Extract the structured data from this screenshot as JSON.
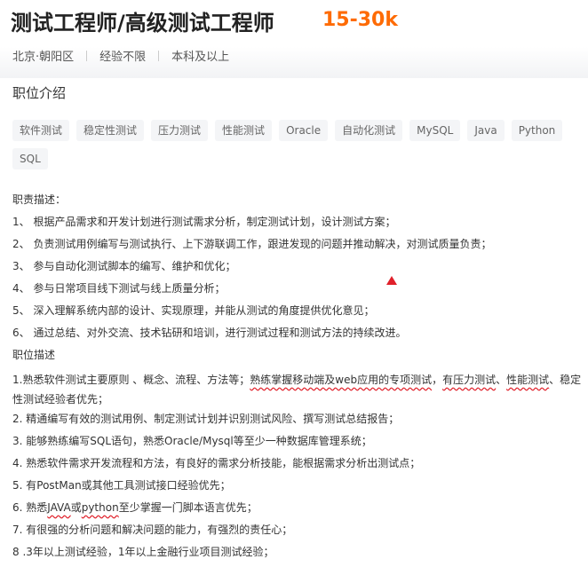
{
  "job": {
    "title": "测试工程师/高级测试工程师",
    "salary": "15-30k",
    "location": "北京·朝阳区",
    "experience": "经验不限",
    "education": "本科及以上"
  },
  "section_title": "职位介绍",
  "tags": [
    "软件测试",
    "稳定性测试",
    "压力测试",
    "性能测试",
    "Oracle",
    "自动化测试",
    "MySQL",
    "Java",
    "Python",
    "SQL"
  ],
  "duties_header": "职责描述：",
  "duties": [
    "1、 根据产品需求和开发计划进行测试需求分析，制定测试计划，设计测试方案；",
    "2、 负责测试用例编写与测试执行、上下游联调工作，跟进发现的问题并推动解决，对测试质量负责；",
    "3、 参与自动化测试脚本的编写、维护和优化；",
    "4、 参与日常项目线下测试与线上质量分析；",
    "5、 深入理解系统内部的设计、实现原理，并能从测试的角度提供优化意见；",
    "6、 通过总结、对外交流、技术钻研和培训，进行测试过程和测试方法的持续改进。"
  ],
  "requirements_header": "职位描述",
  "req1": {
    "prefix": "1.熟悉软件测试主要原则 、概念、流程、方法等；",
    "part_a": "熟练掌握移动端及web应用的专项测试",
    "mid1": "，",
    "part_b": "有压力测试",
    "mid2": "、",
    "part_c": "性能测试",
    "suffix": "、稳定性测试经验者优先；"
  },
  "requirements": [
    "2. 精通编写有效的测试用例、制定测试计划并识别测试风险、撰写测试总结报告；",
    "3. 能够熟练编写SQL语句，熟悉Oracle/Mysql等至少一种数据库管理系统；",
    "4. 熟悉软件需求开发流程和方法，有良好的需求分析技能，能根据需求分析出测试点；",
    "5. 有PostMan或其他工具测试接口经验优先；"
  ],
  "req6": {
    "prefix": "6. 熟悉",
    "java": "JAVA",
    "or": "或",
    "python": "python",
    "suffix": "至少掌握一门脚本语言优先；"
  },
  "requirements_tail": [
    "7. 有很强的分析问题和解决问题的能力，有强烈的责任心；",
    "8 .3年以上测试经验，1年以上金融行业项目测试经验；"
  ],
  "colors": {
    "salary": "#fe6b05",
    "annotation": "#e0202a",
    "tag_bg": "#f4f5f7"
  }
}
